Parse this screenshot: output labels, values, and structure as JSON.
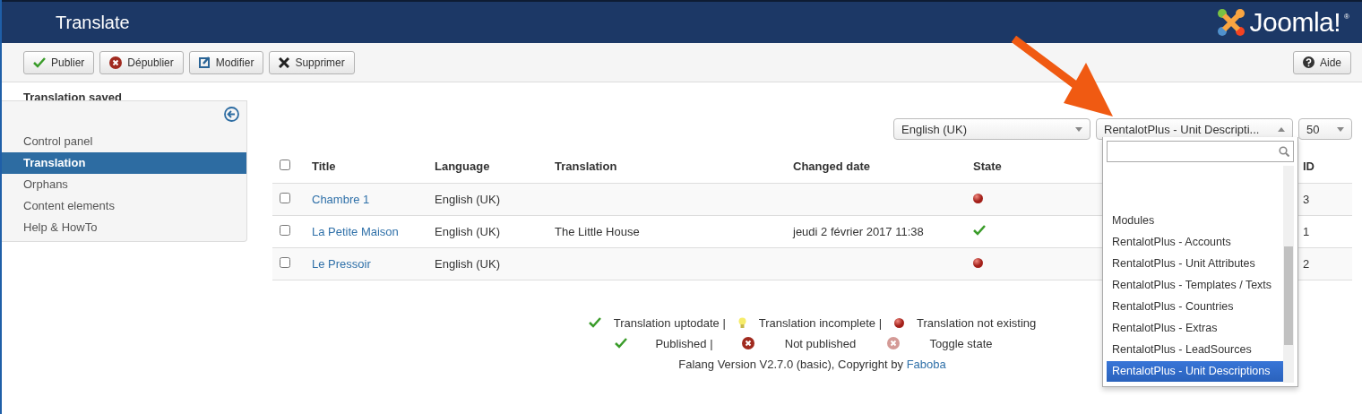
{
  "header": {
    "title": "Translate",
    "logo_text": "Joomla!",
    "logo_mark": "®"
  },
  "toolbar": {
    "buttons": [
      {
        "kind": "publish",
        "label": "Publier"
      },
      {
        "kind": "unpublish",
        "label": "Dépublier"
      },
      {
        "kind": "edit",
        "label": "Modifier"
      },
      {
        "kind": "delete",
        "label": "Supprimer"
      }
    ],
    "help": {
      "kind": "help",
      "label": "Aide"
    }
  },
  "message": "Translation saved",
  "sidebar": {
    "items": [
      {
        "label": "Control panel",
        "selected": false
      },
      {
        "label": "Translation",
        "selected": true
      },
      {
        "label": "Orphans",
        "selected": false
      },
      {
        "label": "Content elements",
        "selected": false
      },
      {
        "label": "Help & HowTo",
        "selected": false
      }
    ]
  },
  "filters": {
    "language": "English (UK)",
    "element": "RentalotPlus - Unit Descripti...",
    "limit": "50"
  },
  "dropdown": {
    "items": [
      {
        "label": "Modules",
        "selected": false
      },
      {
        "label": "RentalotPlus - Accounts",
        "selected": false
      },
      {
        "label": "RentalotPlus - Unit Attributes",
        "selected": false
      },
      {
        "label": "RentalotPlus - Templates / Texts",
        "selected": false
      },
      {
        "label": "RentalotPlus - Countries",
        "selected": false
      },
      {
        "label": "RentalotPlus - Extras",
        "selected": false
      },
      {
        "label": "RentalotPlus - LeadSources",
        "selected": false
      },
      {
        "label": "RentalotPlus - Unit Descriptions",
        "selected": true
      }
    ]
  },
  "table": {
    "select_all_checked": false,
    "columns": [
      "Title",
      "Language",
      "Translation",
      "Changed date",
      "State",
      "ID"
    ],
    "rows": [
      {
        "checked": false,
        "title": "Chambre 1",
        "language": "English (UK)",
        "translation": "",
        "changed": "",
        "kind": "missing",
        "id": "3"
      },
      {
        "checked": false,
        "title": "La Petite Maison",
        "language": "English (UK)",
        "translation": "The Little House",
        "changed": "jeudi 2 février 2017 11:38",
        "kind": "uptodate",
        "id": "1"
      },
      {
        "checked": false,
        "title": "Le Pressoir",
        "language": "English (UK)",
        "translation": "",
        "changed": "",
        "kind": "missing",
        "id": "2"
      }
    ]
  },
  "legend": {
    "rows": [
      [
        {
          "kind": "uptodate",
          "label": "Translation uptodate |"
        },
        {
          "kind": "incomplete",
          "label": "Translation incomplete |"
        },
        {
          "kind": "missing",
          "label": "Translation not existing"
        }
      ],
      [
        {
          "kind": "published",
          "label": "Published |"
        },
        {
          "kind": "unpublished",
          "label": "Not published"
        },
        {
          "kind": "toggle",
          "label": "Toggle state"
        }
      ]
    ],
    "copyright": "Falang Version V2.7.0 (basic), Copyright by",
    "link": "Faboba"
  }
}
